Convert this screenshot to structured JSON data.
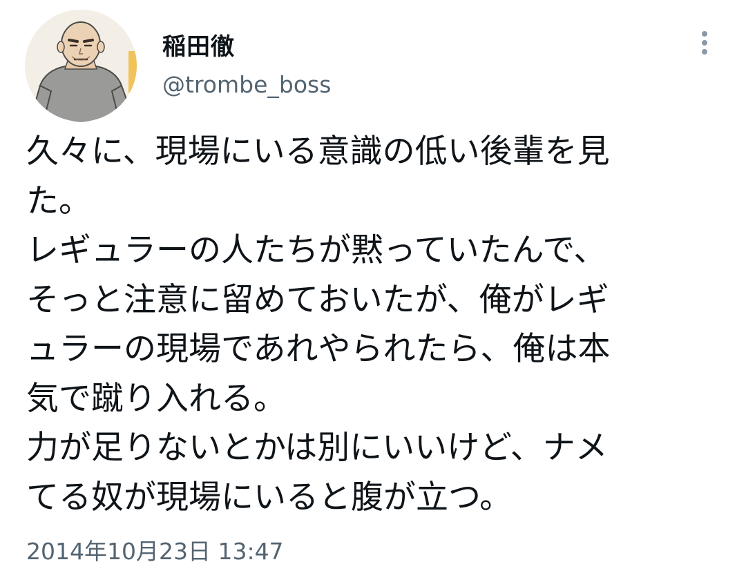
{
  "author": {
    "display_name": "稲田徹",
    "handle": "@trombe_boss",
    "avatar_icon": "cartoon-bald-man-avatar"
  },
  "menu": {
    "icon": "more-vertical-icon"
  },
  "tweet": {
    "lines": [
      "久々に、現場にいる意識の低い後輩を見",
      "た。",
      "レギュラーの人たちが黙っていたんで、",
      "そっと注意に留めておいたが、俺がレギ",
      "ュラーの現場であれやられたら、俺は本",
      "気で蹴り入れる。",
      "力が足りないとかは別にいいけど、ナメ",
      "てる奴が現場にいると腹が立つ。"
    ],
    "timestamp": "2014年10月23日 13:47"
  },
  "colors": {
    "text_primary": "#0f1419",
    "text_secondary": "#536471",
    "background": "#ffffff",
    "menu_dots": "#8b98a5"
  }
}
